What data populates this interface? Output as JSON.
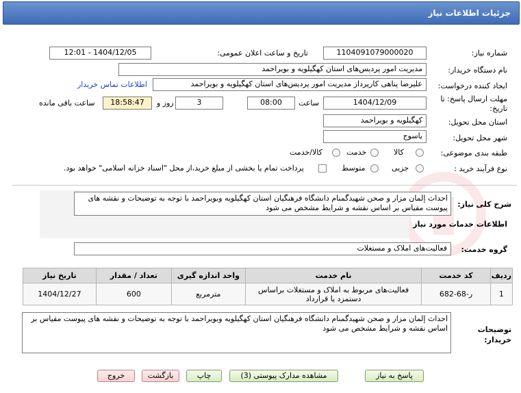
{
  "header": {
    "title": "جزئیات اطلاعات نیاز"
  },
  "form": {
    "need_number_label": "شماره نیاز:",
    "need_number": "1104091079000020",
    "announce_label": "تاریخ و ساعت اعلان عمومی:",
    "announce_value": "1404/12/05 - 12:01",
    "buyer_org_label": "نام دستگاه خریدار:",
    "buyer_org": "مدیریت امور پردیس‌های استان کهگیلویه و بویراحمد",
    "creator_label": "ایجاد کننده درخواست:",
    "creator": "علیرضا پناهی کارپرداز مدیریت امور پردیس‌های استان کهگیلویه و بویراحمد",
    "contact_link": "اطلاعات تماس خریدار",
    "deadline_label": "مهلت ارسال پاسخ: تا تاریخ:",
    "deadline_date": "1404/12/09",
    "time_label": "ساعت",
    "deadline_time": "08:00",
    "days_value": "3",
    "days_label": "روز و",
    "remaining_time": "18:58:47",
    "remaining_label": "ساعت باقی مانده",
    "province_label": "استان محل تحویل:",
    "province": "کهگیلویه و بویراحمد",
    "city_label": "شهر محل تحویل:",
    "city": "یاسوج",
    "category_label": "طبقه بندی موضوعی:",
    "category_options": [
      "کالا",
      "خدمت",
      "کالا/خدمت"
    ],
    "purchase_type_label": "نوع فرآیند خرید :",
    "purchase_options": [
      "جزیی",
      "متوسط"
    ],
    "payment_note": "پرداخت تمام یا بخشی از مبلغ خرید،از محل \"اسناد خزانه اسلامی\" خواهد بود."
  },
  "summary": {
    "label": "شرح کلی نیاز:",
    "text": "احداث إلمان مزار و صحن شهیدگمنام دانشگاه فرهنگیان استان کهگیلویه وبویراحمد با توجه به توضیحات و نقشه های پیوست مقیاس بر اساس نقشه و شرایط مشخص می شود"
  },
  "services": {
    "section_title": "اطلاعات خدمات مورد نیاز",
    "group_label": "گروه خدمت:",
    "group_value": "فعالیت‌های  املاک و مستغلات",
    "columns": [
      "ردیف",
      "کد خدمت",
      "نام خدمت",
      "واحد اندازه گیری",
      "تعداد / مقدار",
      "تاریخ نیاز"
    ],
    "rows": [
      [
        "1",
        "ر-68-682",
        "فعالیت‌های مربوط به املاک و مستغلات براساس دستمزد یا قرارداد",
        "مترمربع",
        "600",
        "1404/12/27"
      ]
    ]
  },
  "buyer_notes": {
    "label": "توضیحات خریدار:",
    "text": "احداث إلمان مزار و صحن شهیدگمنام دانشگاه فرهنگیان استان کهگیلویه وبویراحمد با توجه به توضیحات و نقشه های پیوست مقیاس بر اساس نقشه و شرایط مشخص می شود"
  },
  "buttons": {
    "reply": "پاسخ به نیاز",
    "attachments": "مشاهده مدارک پیوستی (3)",
    "print": "چاپ",
    "back": "بازگشت",
    "exit": "خروج"
  },
  "colors": {
    "header": "#4a78c0",
    "link": "#1a3fd0",
    "remaining_bg": "#fdf3c8"
  }
}
